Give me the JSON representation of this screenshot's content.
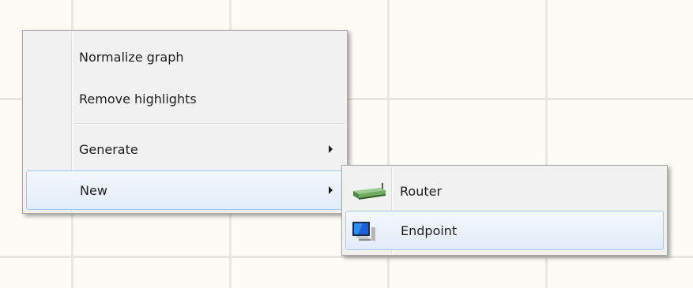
{
  "context_menu": {
    "items": [
      {
        "label": "Normalize graph"
      },
      {
        "label": "Remove highlights"
      },
      {
        "label": "Generate",
        "has_submenu": true
      },
      {
        "label": "New",
        "has_submenu": true,
        "highlighted": true
      }
    ]
  },
  "new_submenu": {
    "items": [
      {
        "label": "Router",
        "icon": "router-icon"
      },
      {
        "label": "Endpoint",
        "icon": "computer-icon",
        "highlighted": true
      }
    ]
  },
  "colors": {
    "canvas_background": "#fdfbf6",
    "grid_line": "#e9e6df",
    "menu_background": "#f1f1f1",
    "highlight_border": "#a9c9ee"
  }
}
